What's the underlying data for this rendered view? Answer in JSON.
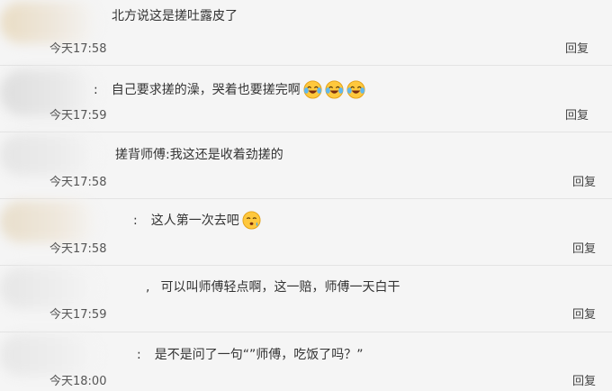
{
  "comments": [
    {
      "text": "北方说这是搓吐露皮了",
      "time": "今天17:58",
      "reply": "回复"
    },
    {
      "text": "自己要求搓的澡，哭着也要搓完啊",
      "time": "今天17:59",
      "reply": "回复",
      "emojis": [
        "laugh-cry-icon",
        "laugh-cry-icon",
        "laugh-cry-icon"
      ]
    },
    {
      "text": "搓背师傅:我这还是收着劲搓的",
      "time": "今天17:58",
      "reply": "回复"
    },
    {
      "text": "这人第一次去吧",
      "time": "今天17:58",
      "reply": "回复",
      "emojis": [
        "sweat-face-icon"
      ]
    },
    {
      "text": "可以叫师傅轻点啊，这一赔，师傅一天白干",
      "time": "今天17:59",
      "reply": "回复"
    },
    {
      "text": "是不是问了一句“”师傅，吃饭了吗？”",
      "time": "今天18:00",
      "reply": "回复"
    }
  ]
}
